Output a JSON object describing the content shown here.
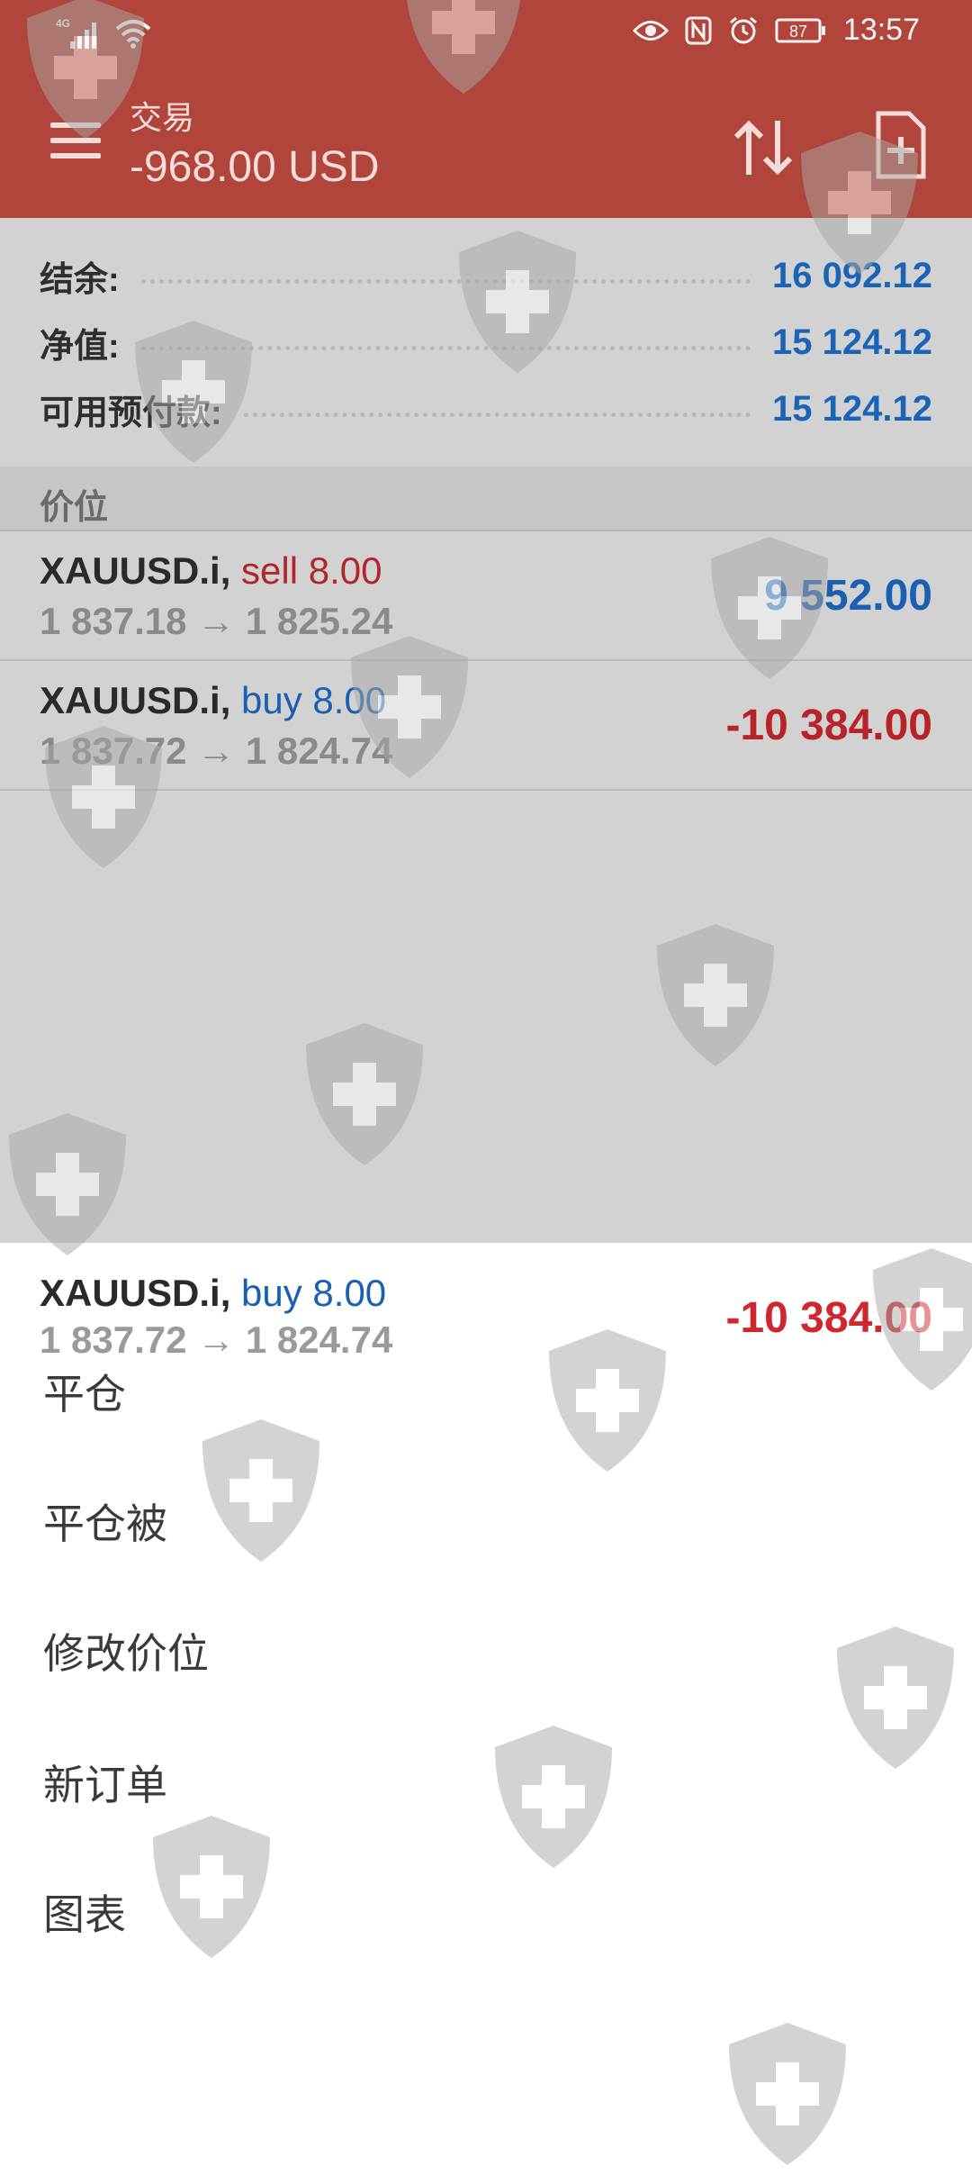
{
  "status_bar": {
    "network": "4G",
    "battery": "87",
    "time": "13:57"
  },
  "app_bar": {
    "title": "交易",
    "subtitle": "-968.00 USD"
  },
  "summary": [
    {
      "label": "结余:",
      "value": "16 092.12"
    },
    {
      "label": "净值:",
      "value": "15 124.12"
    },
    {
      "label": "可用预付款:",
      "value": "15 124.12"
    }
  ],
  "section_header": "价位",
  "positions": [
    {
      "symbol": "XAUUSD.i,",
      "side": "sell 8.00",
      "prices": "1 837.18 → 1 825.24",
      "profit": "9 552.00"
    },
    {
      "symbol": "XAUUSD.i,",
      "side": "buy 8.00",
      "prices": "1 837.72 → 1 824.74",
      "profit": "-10 384.00"
    }
  ],
  "sheet": {
    "symbol": "XAUUSD.i,",
    "side": "buy 8.00",
    "prices": "1 837.72 → 1 824.74",
    "profit": "-10 384.00",
    "menu": [
      "平仓",
      "平仓被",
      "修改价位",
      "新订单",
      "图表"
    ]
  },
  "colors": {
    "app_bar": "#b1443b",
    "profit_blue": "#1a5fb1",
    "loss_red": "#b8232a",
    "scrim_gray": "#d2d2d2"
  },
  "icons": [
    "signal-icon",
    "wifi-icon",
    "eye-icon",
    "nfc-icon",
    "alarm-icon",
    "battery-icon",
    "menu-icon",
    "sort-icon",
    "add-document-icon",
    "watermark-shield-icon"
  ]
}
